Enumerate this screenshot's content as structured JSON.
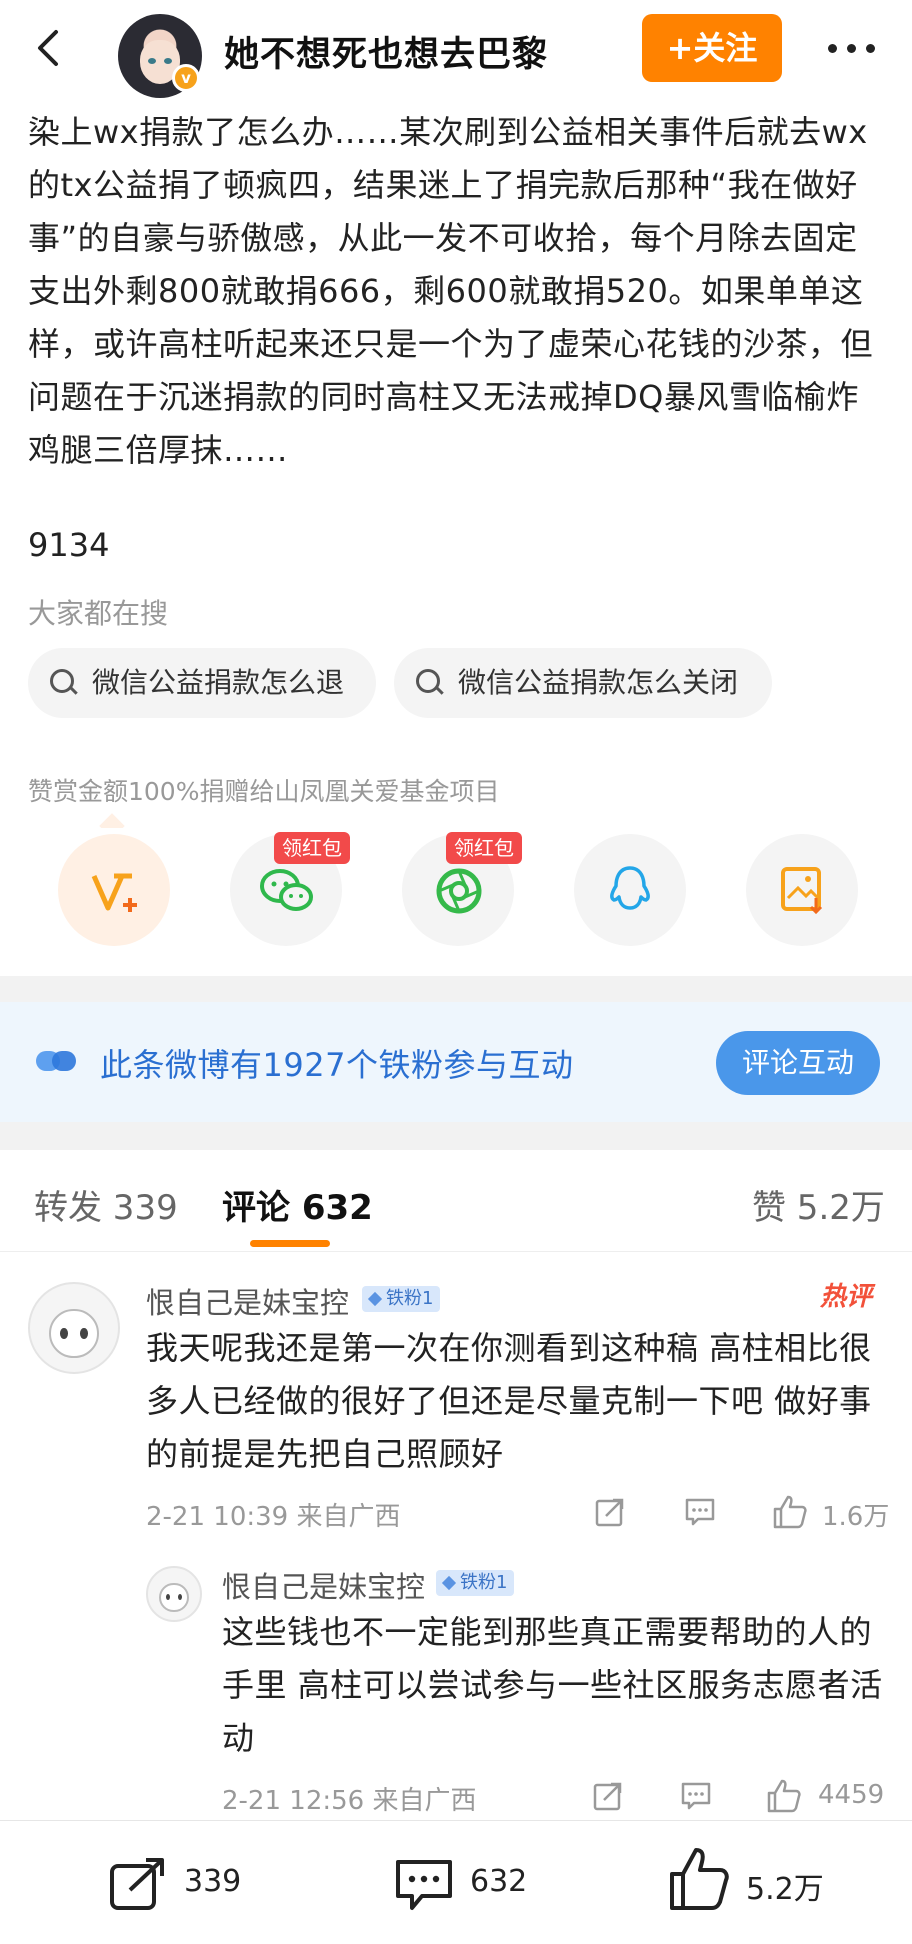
{
  "header": {
    "author": "她不想死也想去巴黎",
    "follow_label": "+关注"
  },
  "post": {
    "text": "染上wx捐款了怎么办……某次刷到公益相关事件后就去wx的tx公益捐了顿疯四，结果迷上了捐完款后那种“我在做好事”的自豪与骄傲感，从此一发不可收拾，每个月除去固定支出外剩800就敢捐666，剩600就敢捐520。如果单单这样，或许高柱听起来还只是一个为了虚荣心花钱的沙茶，但问题在于沉迷捐款的同时高柱又无法戒掉DQ暴风雪临榆炸鸡腿三倍厚抹……",
    "number": "9134"
  },
  "search": {
    "label": "大家都在搜",
    "chips": [
      "微信公益捐款怎么退",
      "微信公益捐款怎么关闭"
    ]
  },
  "reward": {
    "note": "赞赏金额100%捐赠给山凤凰关爱基金项目",
    "share_icons": [
      "reward-v-icon",
      "wechat-icon",
      "moments-icon",
      "qq-icon",
      "save-image-icon"
    ],
    "red_packet_label": "领红包"
  },
  "fans_banner": {
    "text": "此条微博有1927个铁粉参与互动",
    "button": "评论互动"
  },
  "tabs": {
    "repost": "转发 339",
    "comments": "评论 632",
    "likes": "赞 5.2万"
  },
  "comments": [
    {
      "user": "恨自己是妹宝控",
      "badge": "铁粉1",
      "hot_label": "热评",
      "text": "我天呢我还是第一次在你测看到这种稿 高柱相比很多人已经做的很好了但还是尽量克制一下吧 做好事的前提是先把自己照顾好",
      "meta": "2-21 10:39  来自广西",
      "likes": "1.6万"
    },
    {
      "user": "恨自己是妹宝控",
      "badge": "铁粉1",
      "text": "这些钱也不一定能到那些真正需要帮助的人的手里 高柱可以尝试参与一些社区服务志愿者活动",
      "meta": "2-21 12:56  来自广西",
      "likes": "4459"
    }
  ],
  "bottom_bar": {
    "repost": "339",
    "comment": "632",
    "like": "5.2万"
  },
  "colors": {
    "accent": "#ff8200",
    "link_blue": "#2a6fd1",
    "hot_red": "#f2513a"
  }
}
